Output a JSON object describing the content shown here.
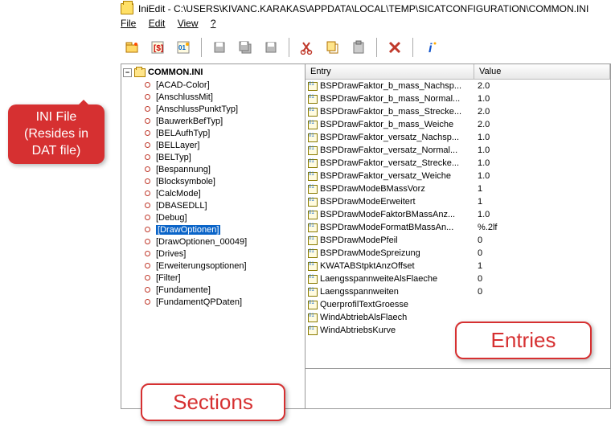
{
  "title": "IniEdit - C:\\USERS\\KIVANC.KARAKAS\\APPDATA\\LOCAL\\TEMP\\SICATCONFIGURATION\\COMMON.INI",
  "menu": {
    "file": "File",
    "edit": "Edit",
    "view": "View",
    "help": "?"
  },
  "tree": {
    "root": "COMMON.INI",
    "sections": [
      "[ACAD-Color]",
      "[AnschlussMit]",
      "[AnschlussPunktTyp]",
      "[BauwerkBefTyp]",
      "[BELAufhTyp]",
      "[BELLayer]",
      "[BELTyp]",
      "[Bespannung]",
      "[Blocksymbole]",
      "[CalcMode]",
      "[DBASEDLL]",
      "[Debug]",
      "[DrawOptionen]",
      "[DrawOptionen_00049]",
      "[Drives]",
      "[Erweiterungsoptionen]",
      "[Filter]",
      "[Fundamente]",
      "[FundamentQPDaten]"
    ],
    "selected_index": 12
  },
  "columns": {
    "entry": "Entry",
    "value": "Value"
  },
  "entries": [
    {
      "name": "BSPDrawFaktor_b_mass_Nachsp...",
      "value": "2.0"
    },
    {
      "name": "BSPDrawFaktor_b_mass_Normal...",
      "value": "1.0"
    },
    {
      "name": "BSPDrawFaktor_b_mass_Strecke...",
      "value": "2.0"
    },
    {
      "name": "BSPDrawFaktor_b_mass_Weiche",
      "value": "2.0"
    },
    {
      "name": "BSPDrawFaktor_versatz_Nachsp...",
      "value": "1.0"
    },
    {
      "name": "BSPDrawFaktor_versatz_Normal...",
      "value": "1.0"
    },
    {
      "name": "BSPDrawFaktor_versatz_Strecke...",
      "value": "1.0"
    },
    {
      "name": "BSPDrawFaktor_versatz_Weiche",
      "value": "1.0"
    },
    {
      "name": "BSPDrawModeBMassVorz",
      "value": "1"
    },
    {
      "name": "BSPDrawModeErweitert",
      "value": "1"
    },
    {
      "name": "BSPDrawModeFaktorBMassAnz...",
      "value": "1.0"
    },
    {
      "name": "BSPDrawModeFormatBMassAn...",
      "value": "%.2lf"
    },
    {
      "name": "BSPDrawModePfeil",
      "value": "0"
    },
    {
      "name": "BSPDrawModeSpreizung",
      "value": "0"
    },
    {
      "name": "KWATABStpktAnzOffset",
      "value": "1"
    },
    {
      "name": "LaengsspannweiteAlsFlaeche",
      "value": "0"
    },
    {
      "name": "Laengsspannweiten",
      "value": "0"
    },
    {
      "name": "QuerprofilTextGroesse",
      "value": ""
    },
    {
      "name": "WindAbtriebAlsFlaech",
      "value": ""
    },
    {
      "name": "WindAbtriebsKurve",
      "value": ""
    }
  ],
  "callouts": {
    "inifile": "INI File (Resides in DAT file)",
    "sections": "Sections",
    "entries": "Entries"
  },
  "icons": {
    "open": "open-icon",
    "currency": "currency-icon",
    "binary": "binary-icon",
    "disk1": "save-icon",
    "disk2": "save-all-icon",
    "disk3": "export-icon",
    "cut": "cut-icon",
    "copy": "copy-icon",
    "paste": "paste-icon",
    "delete": "delete-icon",
    "info": "info-icon"
  }
}
